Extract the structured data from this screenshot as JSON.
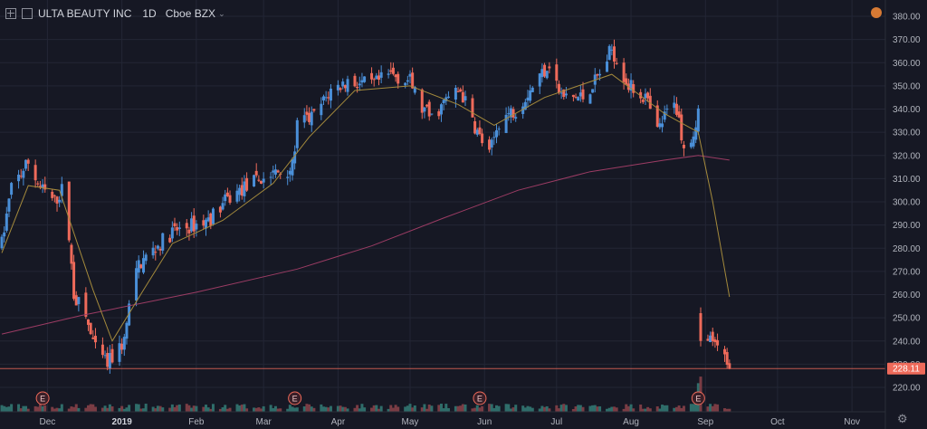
{
  "header": {
    "symbol": "ULTA BEAUTY INC",
    "interval": "1D",
    "exchange": "Cboe BZX"
  },
  "price_badge": "228.11",
  "colors": {
    "up": "#4a8fd8",
    "down": "#ee6a5a",
    "ma_short": "#a48a3c",
    "ma_long": "#9c3c64",
    "grid": "#232635",
    "vol_up": "#2f6d6a",
    "vol_down": "#7a3c44"
  },
  "chart_data": {
    "type": "candlestick",
    "y_axis": {
      "range": [
        212,
        383
      ],
      "ticks": [
        220,
        230,
        240,
        250,
        260,
        270,
        280,
        290,
        300,
        310,
        320,
        330,
        340,
        350,
        360,
        370,
        380
      ],
      "labels": [
        "220.00",
        "230.00",
        "240.00",
        "250.00",
        "260.00",
        "270.00",
        "280.00",
        "290.00",
        "300.00",
        "310.00",
        "320.00",
        "330.00",
        "340.00",
        "350.00",
        "360.00",
        "370.00",
        "380.00"
      ]
    },
    "x_axis": {
      "labels": [
        {
          "text": "Dec",
          "date": "2018-12-01",
          "bold": false
        },
        {
          "text": "2019",
          "date": "2019-01-01",
          "bold": true
        },
        {
          "text": "Feb",
          "date": "2019-02-01",
          "bold": false
        },
        {
          "text": "Mar",
          "date": "2019-03-01",
          "bold": false
        },
        {
          "text": "Apr",
          "date": "2019-04-01",
          "bold": false
        },
        {
          "text": "May",
          "date": "2019-05-01",
          "bold": false
        },
        {
          "text": "Jun",
          "date": "2019-06-01",
          "bold": false
        },
        {
          "text": "Jul",
          "date": "2019-07-01",
          "bold": false
        },
        {
          "text": "Aug",
          "date": "2019-08-01",
          "bold": false
        },
        {
          "text": "Sep",
          "date": "2019-09-01",
          "bold": false
        },
        {
          "text": "Oct",
          "date": "2019-10-01",
          "bold": false
        },
        {
          "text": "Nov",
          "date": "2019-11-01",
          "bold": false
        }
      ]
    },
    "last_price": 228.11,
    "earnings_markers": [
      {
        "label": "E",
        "date": "2018-11-29"
      },
      {
        "label": "E",
        "date": "2019-03-14"
      },
      {
        "label": "E",
        "date": "2019-05-30"
      },
      {
        "label": "E",
        "date": "2019-08-29"
      }
    ],
    "price_path": [
      [
        "2018-11-12",
        282
      ],
      [
        "2018-11-16",
        306
      ],
      [
        "2018-11-23",
        317
      ],
      [
        "2018-11-28",
        306
      ],
      [
        "2018-12-04",
        300
      ],
      [
        "2018-12-07",
        305
      ],
      [
        "2018-12-10",
        285
      ],
      [
        "2018-12-12",
        260
      ],
      [
        "2018-12-17",
        250
      ],
      [
        "2018-12-21",
        236
      ],
      [
        "2018-12-26",
        230
      ],
      [
        "2019-01-02",
        240
      ],
      [
        "2019-01-04",
        255
      ],
      [
        "2019-01-08",
        273
      ],
      [
        "2019-01-15",
        280
      ],
      [
        "2019-01-22",
        287
      ],
      [
        "2019-01-31",
        290
      ],
      [
        "2019-02-06",
        292
      ],
      [
        "2019-02-13",
        300
      ],
      [
        "2019-02-22",
        307
      ],
      [
        "2019-03-05",
        312
      ],
      [
        "2019-03-13",
        315
      ],
      [
        "2019-03-15",
        333
      ],
      [
        "2019-03-22",
        337
      ],
      [
        "2019-03-29",
        348
      ],
      [
        "2019-04-05",
        352
      ],
      [
        "2019-04-15",
        350
      ],
      [
        "2019-04-23",
        355
      ],
      [
        "2019-05-01",
        352
      ],
      [
        "2019-05-06",
        340
      ],
      [
        "2019-05-10",
        336
      ],
      [
        "2019-05-17",
        345
      ],
      [
        "2019-05-22",
        348
      ],
      [
        "2019-05-29",
        330
      ],
      [
        "2019-06-03",
        320
      ],
      [
        "2019-06-07",
        335
      ],
      [
        "2019-06-14",
        340
      ],
      [
        "2019-06-21",
        350
      ],
      [
        "2019-06-28",
        360
      ],
      [
        "2019-07-03",
        345
      ],
      [
        "2019-07-12",
        345
      ],
      [
        "2019-07-19",
        355
      ],
      [
        "2019-07-24",
        366
      ],
      [
        "2019-07-31",
        350
      ],
      [
        "2019-08-07",
        345
      ],
      [
        "2019-08-12",
        330
      ],
      [
        "2019-08-19",
        345
      ],
      [
        "2019-08-23",
        325
      ],
      [
        "2019-08-27",
        330
      ],
      [
        "2019-08-29",
        338
      ],
      [
        "2019-08-30",
        252
      ],
      [
        "2019-09-04",
        238
      ],
      [
        "2019-09-09",
        234
      ],
      [
        "2019-09-11",
        228.11
      ]
    ],
    "ma_short": [
      [
        "2018-11-12",
        278
      ],
      [
        "2018-11-23",
        307
      ],
      [
        "2018-12-06",
        305
      ],
      [
        "2018-12-20",
        262
      ],
      [
        "2018-12-28",
        240
      ],
      [
        "2019-01-10",
        262
      ],
      [
        "2019-01-22",
        282
      ],
      [
        "2019-02-12",
        292
      ],
      [
        "2019-03-05",
        308
      ],
      [
        "2019-03-20",
        328
      ],
      [
        "2019-04-08",
        348
      ],
      [
        "2019-05-01",
        350
      ],
      [
        "2019-05-21",
        342
      ],
      [
        "2019-06-05",
        333
      ],
      [
        "2019-06-26",
        345
      ],
      [
        "2019-07-24",
        355
      ],
      [
        "2019-08-15",
        338
      ],
      [
        "2019-08-29",
        330
      ],
      [
        "2019-09-04",
        300
      ],
      [
        "2019-09-11",
        259
      ]
    ],
    "ma_long": [
      [
        "2018-11-12",
        243
      ],
      [
        "2018-12-15",
        251
      ],
      [
        "2019-02-01",
        261
      ],
      [
        "2019-03-15",
        271
      ],
      [
        "2019-04-15",
        281
      ],
      [
        "2019-05-15",
        293
      ],
      [
        "2019-06-15",
        305
      ],
      [
        "2019-07-15",
        313
      ],
      [
        "2019-08-15",
        318
      ],
      [
        "2019-08-29",
        320
      ],
      [
        "2019-09-11",
        318
      ]
    ]
  }
}
